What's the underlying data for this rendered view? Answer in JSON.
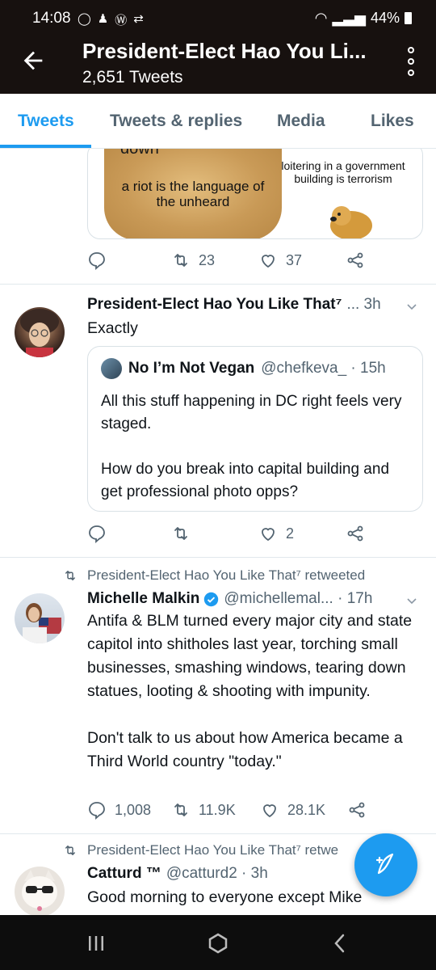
{
  "status_bar": {
    "time": "14:08",
    "battery": "44%"
  },
  "header": {
    "title": "President-Elect Hao You Li...",
    "subtitle": "2,651 Tweets"
  },
  "tabs": [
    {
      "label": "Tweets",
      "active": true
    },
    {
      "label": "Tweets & replies",
      "active": false
    },
    {
      "label": "Media",
      "active": false
    },
    {
      "label": "Likes",
      "active": false
    }
  ],
  "tweet1": {
    "meme_text": {
      "top": "down",
      "left": "a riot is the language of the unheard",
      "right": "loitering in a government building is terrorism"
    },
    "retweets": "23",
    "likes": "37"
  },
  "tweet2": {
    "name": "President-Elect Hao You Like That⁷",
    "meta": "... 3h",
    "text": "Exactly",
    "quote": {
      "name": "No I’m Not Vegan",
      "handle_time": "@chefkeva_ · 15h",
      "text_1": "All this stuff happening in DC right feels very staged.",
      "text_2": "How do you break into capital building and get professional photo opps?"
    },
    "likes": "2"
  },
  "tweet3": {
    "retweeted_by": "President-Elect Hao You Like That⁷ retweeted",
    "name": "Michelle Malkin",
    "meta": "@michellemal... · 17h",
    "text_1": "Antifa & BLM turned every major city and state capitol into shitholes last year, torching small businesses, smashing windows, tearing down statues, looting & shooting with impunity.",
    "text_2": "Don't talk to us about how America became a Third World country \"today.\"",
    "replies": "1,008",
    "retweets": "11.9K",
    "likes": "28.1K"
  },
  "tweet4": {
    "retweeted_by": "President-Elect Hao You Like That⁷ retwe",
    "name": "Catturd ™",
    "meta": "@catturd2 · 3h",
    "text": "Good morning to everyone except Mike"
  },
  "colors": {
    "accent": "#1d9bf0",
    "header_bg": "#17110f",
    "muted": "#536471"
  }
}
